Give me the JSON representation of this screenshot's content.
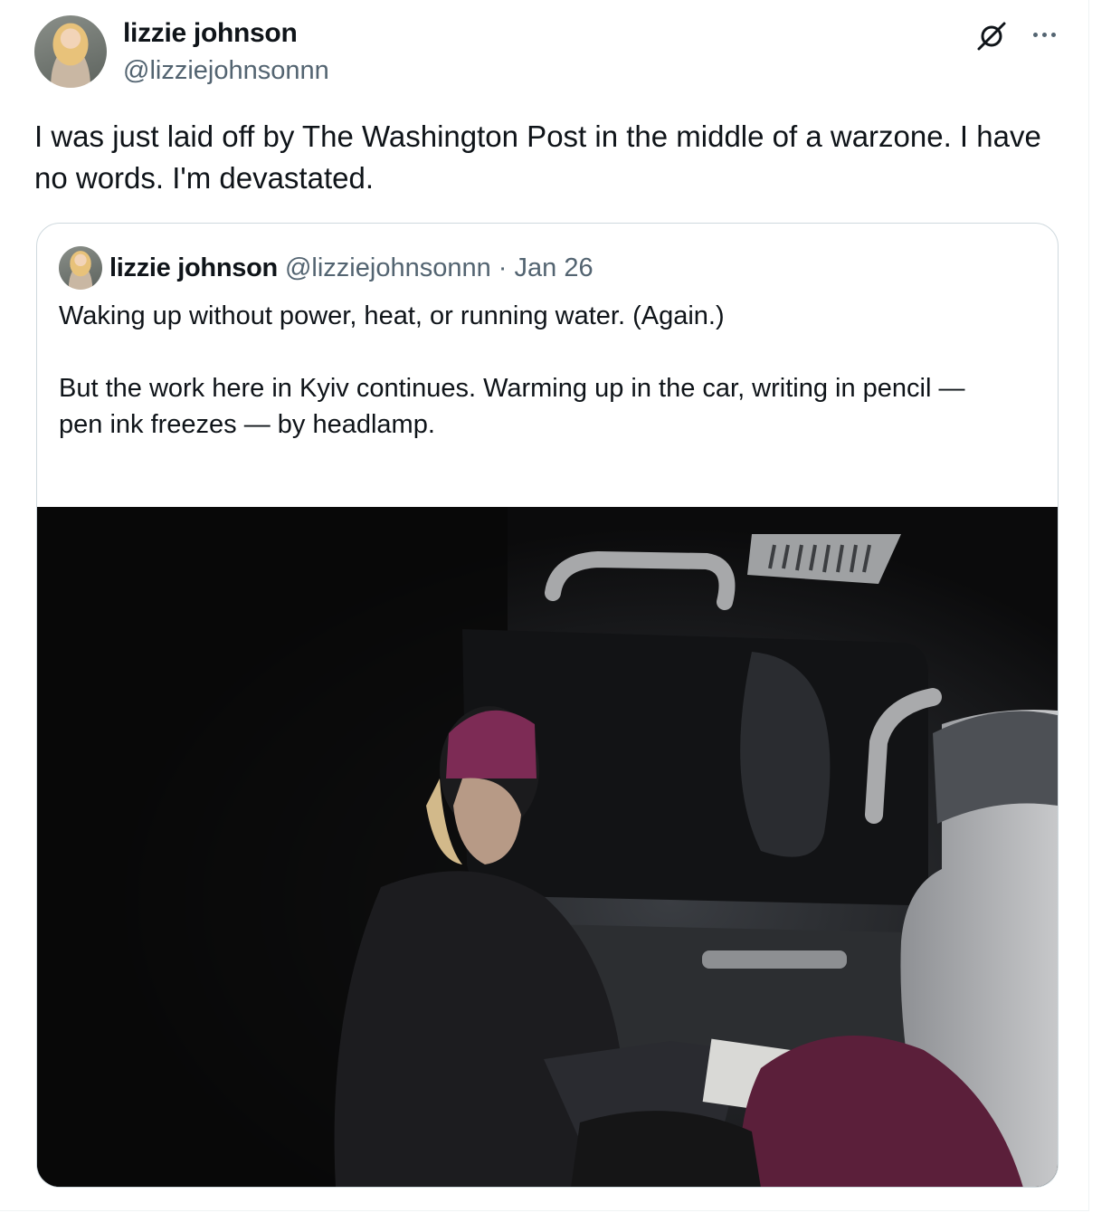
{
  "post": {
    "author_name": "lizzie johnson",
    "author_handle": "@lizziejohnsonnn",
    "text": "I was just laid off by The Washington Post in the middle of a warzone. I have no words. I'm devastated.",
    "icons": [
      "grok-icon",
      "more-icon",
      "avatar"
    ]
  },
  "quoted_post": {
    "author_name": "lizzie johnson",
    "author_handle": "@lizziejohnsonnn",
    "separator": "·",
    "date": "Jan 26",
    "lines": [
      "Waking up without power, heat, or running water. (Again.)",
      "",
      "But the work here in Kyiv continues. Warming up in the car, writing in pencil —",
      "pen ink freezes — by headlamp."
    ],
    "truncation": "...",
    "photo_alt": "A woman in a purple knit hat writing in a notebook inside a dark car"
  }
}
